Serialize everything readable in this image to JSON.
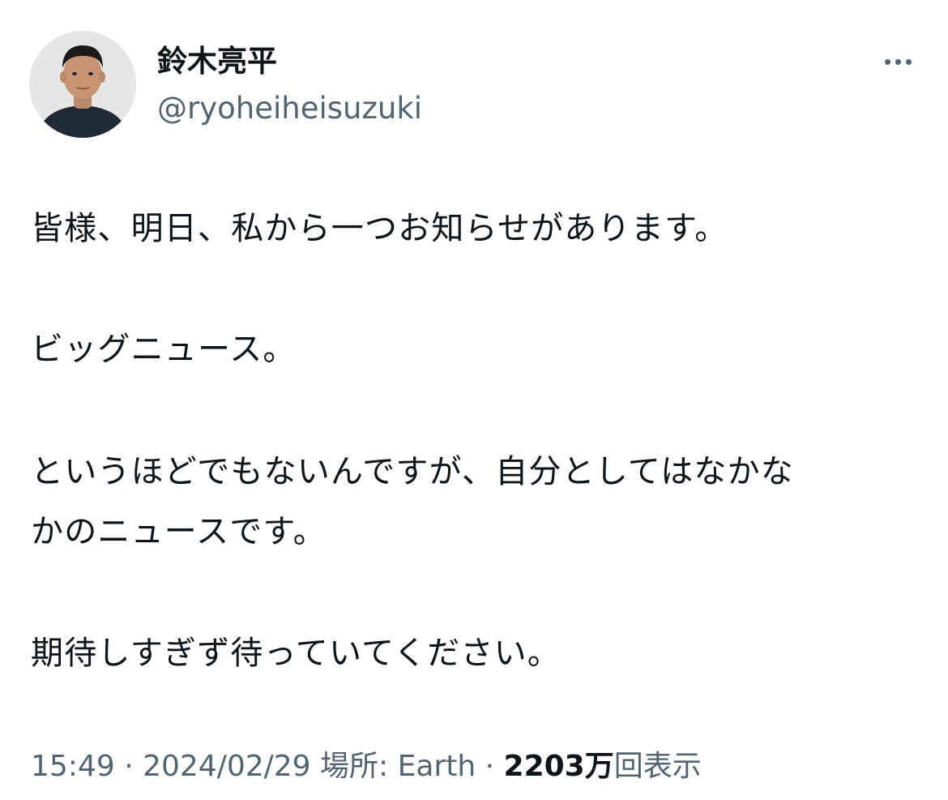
{
  "author": {
    "display_name": "鈴木亮平",
    "handle": "@ryoheiheisuzuki"
  },
  "tweet": {
    "lines": [
      "皆様、明日、私から一つお知らせがあります。",
      "ビッグニュース。",
      "というほどでもないんですが、自分としてはなかな",
      "かのニュースです。",
      "期待しすぎず待っていてください。"
    ]
  },
  "meta": {
    "time": "15:49",
    "sep1": " · ",
    "date": "2024/02/29",
    "location_label": "場所: Earth",
    "sep2": " · ",
    "views_count": "2203万",
    "views_label": "回表示"
  },
  "icons": {
    "more": "more-horizontal-icon"
  },
  "colors": {
    "text_primary": "#0f1419",
    "text_secondary": "#536471",
    "background": "#ffffff"
  }
}
